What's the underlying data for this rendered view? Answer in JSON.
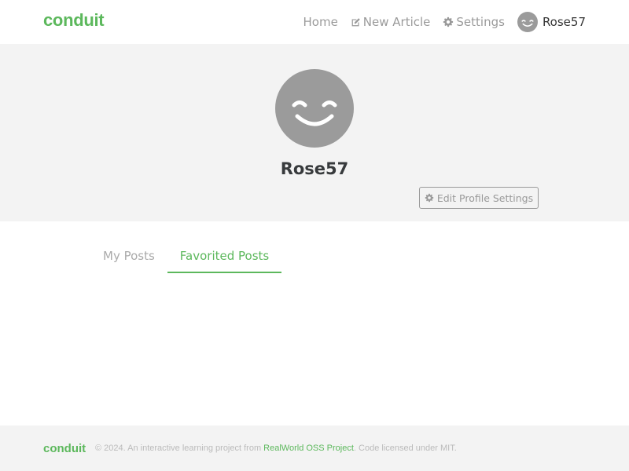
{
  "navbar": {
    "brand": "conduit",
    "items": [
      {
        "label": "Home",
        "icon": null
      },
      {
        "label": "New Article",
        "icon": "edit-icon"
      },
      {
        "label": "Settings",
        "icon": "gear-icon"
      }
    ],
    "user": {
      "name": "Rose57",
      "icon": "smiley-avatar-icon"
    }
  },
  "profile": {
    "username": "Rose57",
    "avatar_icon": "smiley-avatar-icon",
    "edit_button": {
      "label": "Edit Profile Settings",
      "icon": "gear-icon"
    }
  },
  "tabs": {
    "items": [
      {
        "label": "My Posts",
        "active": false
      },
      {
        "label": "Favorited Posts",
        "active": true
      }
    ]
  },
  "footer": {
    "brand": "conduit",
    "text_before": "© 2024. An interactive learning project from ",
    "link_label": "RealWorld OSS Project",
    "text_after": ". Code licensed under MIT."
  },
  "colors": {
    "accent": "#5cb85c",
    "avatar_bg": "#9b9b9b",
    "banner_bg": "#f3f3f3"
  }
}
